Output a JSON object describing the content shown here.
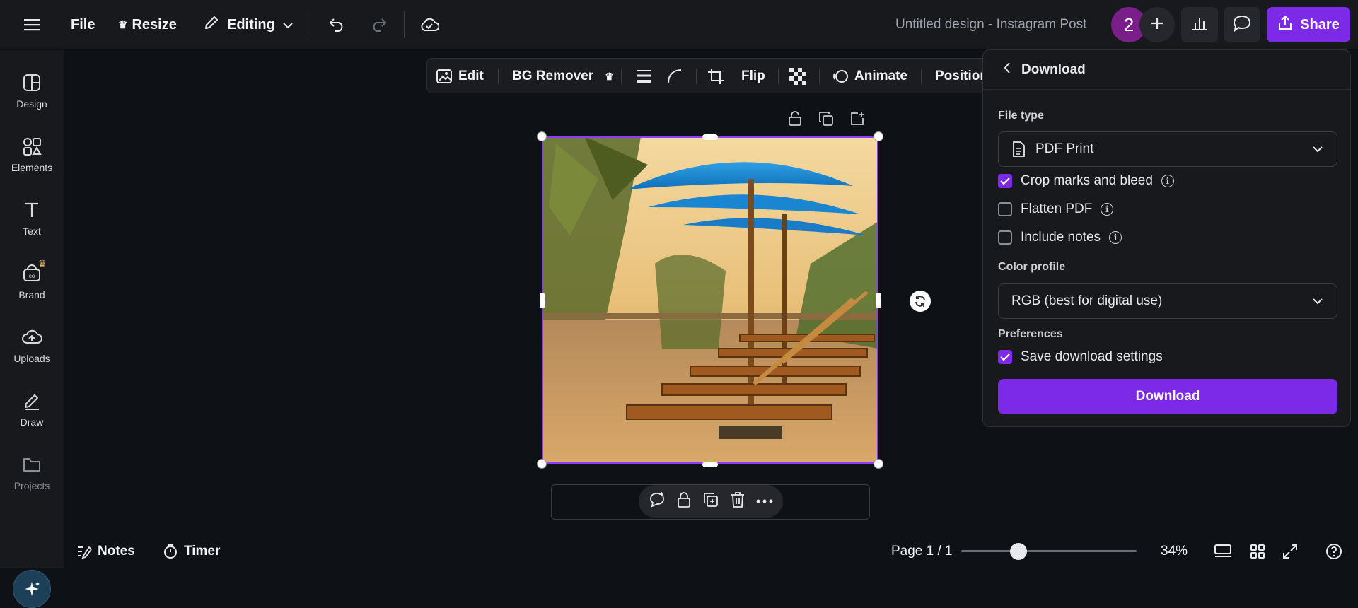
{
  "topbar": {
    "file_label": "File",
    "resize_label": "Resize",
    "editing_label": "Editing",
    "title": "Untitled design - Instagram Post",
    "collaborator_count": "2",
    "share_label": "Share"
  },
  "sidebar": {
    "items": [
      {
        "label": "Design",
        "icon": "design-icon"
      },
      {
        "label": "Elements",
        "icon": "elements-icon"
      },
      {
        "label": "Text",
        "icon": "text-icon"
      },
      {
        "label": "Brand",
        "icon": "brand-icon"
      },
      {
        "label": "Uploads",
        "icon": "uploads-icon"
      },
      {
        "label": "Draw",
        "icon": "draw-icon"
      },
      {
        "label": "Projects",
        "icon": "projects-icon"
      }
    ]
  },
  "context_toolbar": {
    "edit_label": "Edit",
    "bg_remover_label": "BG Remover",
    "flip_label": "Flip",
    "animate_label": "Animate",
    "position_label": "Position"
  },
  "download_panel": {
    "title": "Download",
    "file_type_label": "File type",
    "file_type_value": "PDF Print",
    "options": [
      {
        "label": "Crop marks and bleed",
        "checked": true
      },
      {
        "label": "Flatten PDF",
        "checked": false
      },
      {
        "label": "Include notes",
        "checked": false
      }
    ],
    "color_profile_label": "Color profile",
    "color_profile_value": "RGB (best for digital use)",
    "preferences_label": "Preferences",
    "save_settings_label": "Save download settings",
    "save_settings_checked": true,
    "download_button_label": "Download"
  },
  "bottombar": {
    "notes_label": "Notes",
    "timer_label": "Timer",
    "page_indicator": "Page 1 / 1",
    "zoom_value": "34%"
  },
  "colors": {
    "accent": "#7d2ae8",
    "background": "#0e1116",
    "panel": "#17191d"
  }
}
